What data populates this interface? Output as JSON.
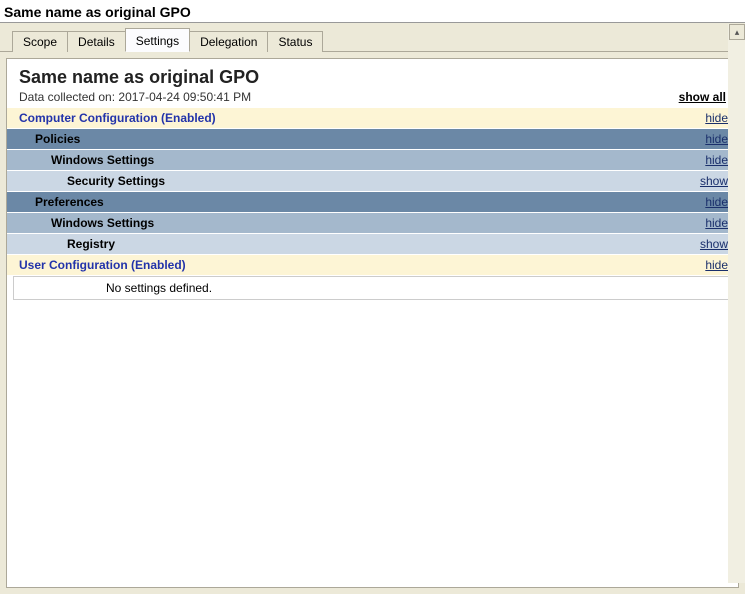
{
  "windowTitle": "Same name as original GPO",
  "tabs": [
    {
      "label": "Scope",
      "active": false
    },
    {
      "label": "Details",
      "active": false
    },
    {
      "label": "Settings",
      "active": true
    },
    {
      "label": "Delegation",
      "active": false
    },
    {
      "label": "Status",
      "active": false
    }
  ],
  "report": {
    "title": "Same name as original GPO",
    "collectedPrefix": "Data collected on: ",
    "collectedTime": "2017-04-24 09:50:41 PM",
    "showAllLabel": "show all"
  },
  "sections": {
    "computerConfig": {
      "label": "Computer Configuration (Enabled)",
      "toggle": "hide"
    },
    "policies": {
      "label": "Policies",
      "toggle": "hide"
    },
    "winSettings1": {
      "label": "Windows Settings",
      "toggle": "hide"
    },
    "secSettings": {
      "label": "Security Settings",
      "toggle": "show"
    },
    "preferences": {
      "label": "Preferences",
      "toggle": "hide"
    },
    "winSettings2": {
      "label": "Windows Settings",
      "toggle": "hide"
    },
    "registry": {
      "label": "Registry",
      "toggle": "show"
    },
    "userConfig": {
      "label": "User Configuration (Enabled)",
      "toggle": "hide"
    }
  },
  "userConfigBody": "No settings defined."
}
